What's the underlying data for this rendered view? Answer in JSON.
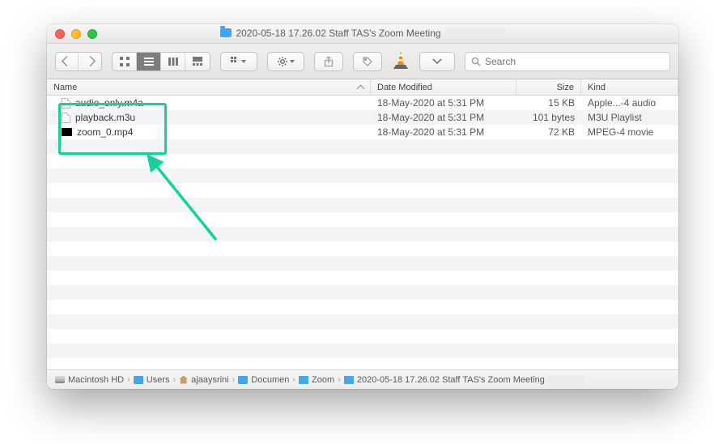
{
  "window": {
    "title": "2020-05-18 17.26.02 Staff TAS's Zoom Meeting"
  },
  "toolbar": {
    "search_placeholder": "Search"
  },
  "columns": {
    "name": "Name",
    "date_modified": "Date Modified",
    "size": "Size",
    "kind": "Kind"
  },
  "files": [
    {
      "name": "audio_only.m4a",
      "date": "18-May-2020 at 5:31 PM",
      "size": "15 KB",
      "kind": "Apple...-4 audio",
      "icon": "doc"
    },
    {
      "name": "playback.m3u",
      "date": "18-May-2020 at 5:31 PM",
      "size": "101 bytes",
      "kind": "M3U Playlist",
      "icon": "doc"
    },
    {
      "name": "zoom_0.mp4",
      "date": "18-May-2020 at 5:31 PM",
      "size": "72 KB",
      "kind": "MPEG-4 movie",
      "icon": "black"
    }
  ],
  "path": [
    {
      "label": "Macintosh HD",
      "icon": "disk"
    },
    {
      "label": "Users",
      "icon": "fold"
    },
    {
      "label": "ajaaysrini",
      "icon": "home"
    },
    {
      "label": "Documen",
      "icon": "fold"
    },
    {
      "label": "Zoom",
      "icon": "fold"
    },
    {
      "label": "2020-05-18 17.26.02 Staff TAS's Zoom Meeting",
      "icon": "fold"
    }
  ],
  "annotation": {
    "color": "#10d59b"
  }
}
